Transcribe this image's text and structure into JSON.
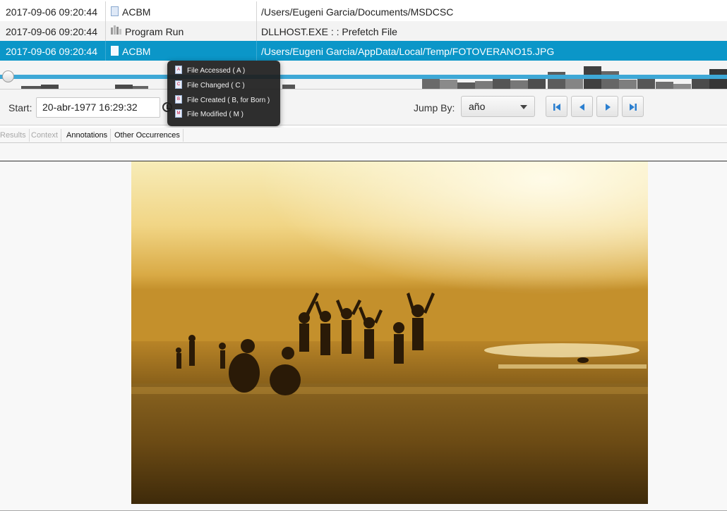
{
  "events": [
    {
      "datetime": "2017-09-06 09:20:44",
      "type": "ACBM",
      "type_icon": "document-icon",
      "description": "/Users/Eugeni Garcia/Documents/MSDCSC",
      "selected": false
    },
    {
      "datetime": "2017-09-06 09:20:44",
      "type": "Program Run",
      "type_icon": "program-run-icon",
      "description": "DLLHOST.EXE : : Prefetch File",
      "selected": false
    },
    {
      "datetime": "2017-09-06 09:20:44",
      "type": "ACBM",
      "type_icon": "document-icon",
      "description": "/Users/Eugeni Garcia/AppData/Local/Temp/FOTOVERANO15.JPG",
      "selected": true
    }
  ],
  "controls": {
    "start_label": "Start:",
    "start_value": "20-abr-1977 16:29:32",
    "jump_label": "Jump By:",
    "jump_value": "año"
  },
  "popup": {
    "items": [
      {
        "label": "File Accessed ( A )",
        "badge": "A"
      },
      {
        "label": "File Changed ( C )",
        "badge": "C"
      },
      {
        "label": "File Created ( B, for Born )",
        "badge": "B"
      },
      {
        "label": "File Modified ( M )",
        "badge": "M"
      }
    ]
  },
  "tabs": [
    "Results",
    "Context",
    "Annotations",
    "Other Occurrences"
  ],
  "colors": {
    "selection": "#0b96c8",
    "timeline_track": "#3ea8d6"
  }
}
